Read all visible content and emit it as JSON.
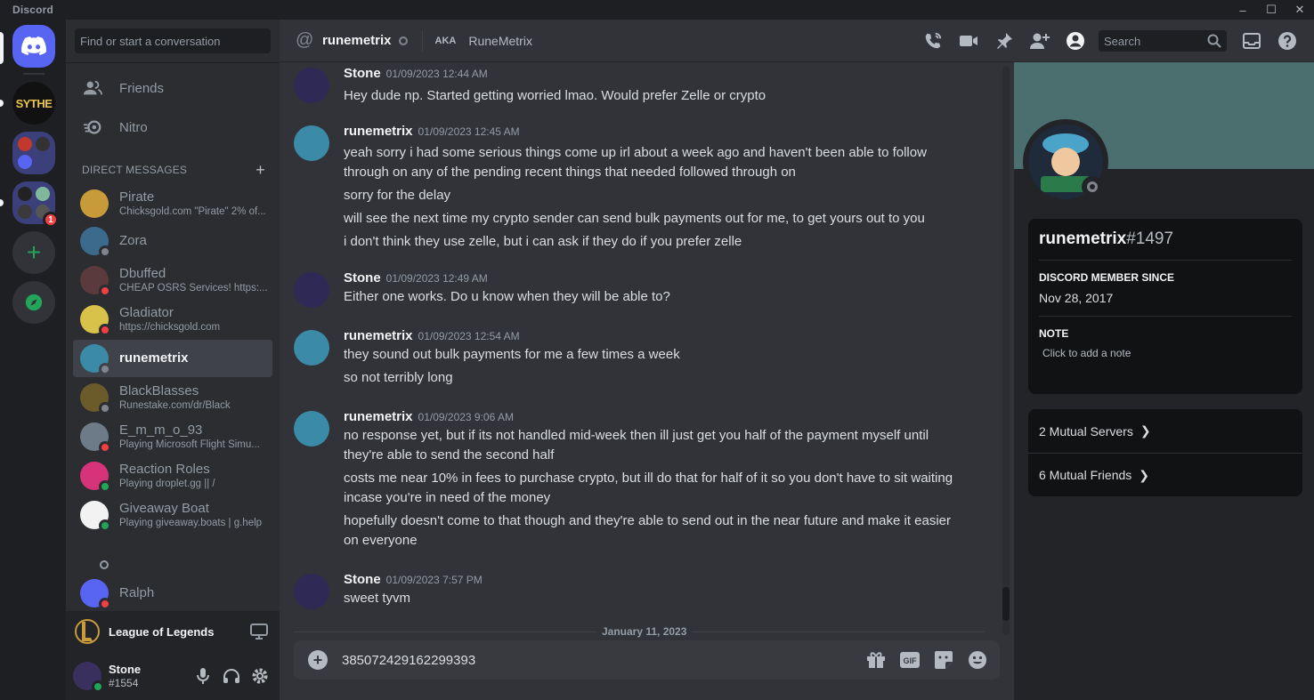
{
  "app": {
    "title": "Discord"
  },
  "window_controls": [
    "–",
    "☐",
    "✕"
  ],
  "servers": [
    {
      "name": "SYTHE",
      "label": "SYTHE"
    },
    {
      "name": "folder-1"
    },
    {
      "name": "folder-2",
      "badge": "1"
    }
  ],
  "sidebar": {
    "search_placeholder": "Find or start a conversation",
    "nav": [
      {
        "label": "Friends"
      },
      {
        "label": "Nitro"
      }
    ],
    "dm_header": "DIRECT MESSAGES",
    "dms": [
      {
        "name": "Pirate",
        "sub": "Chicksgold.com \"Pirate\" 2% of...",
        "status": "none"
      },
      {
        "name": "Zora",
        "sub": "",
        "status": "offline"
      },
      {
        "name": "Dbuffed",
        "sub": "CHEAP OSRS Services! https:...",
        "status": "dnd"
      },
      {
        "name": "Gladiator",
        "sub": "https://chicksgold.com",
        "status": "dnd"
      },
      {
        "name": "runemetrix",
        "sub": "",
        "status": "offline"
      },
      {
        "name": "BlackBlasses",
        "sub": "Runestake.com/dr/Black",
        "status": "offline"
      },
      {
        "name": "E_m_m_o_93",
        "sub": "Playing Microsoft Flight Simu...",
        "status": "dnd"
      },
      {
        "name": "Reaction Roles",
        "sub": "Playing droplet.gg || /",
        "status": "online"
      },
      {
        "name": "Giveaway Boat",
        "sub": "Playing giveaway.boats | g.help",
        "status": "online"
      },
      {
        "name": "Ralph",
        "sub": "",
        "status": "dnd"
      }
    ],
    "activity": {
      "game": "League of Legends"
    },
    "user": {
      "name": "Stone",
      "tag": "#1554"
    }
  },
  "header": {
    "channel": "runemetrix",
    "aka_label": "AKA",
    "aka_name": "RuneMetrix",
    "search_placeholder": "Search"
  },
  "messages": [
    {
      "author": "Stone",
      "time": "01/09/2023 12:44 AM",
      "lines": [
        "Hey dude np. Started getting worried lmao. Would prefer Zelle or crypto"
      ]
    },
    {
      "author": "runemetrix",
      "time": "01/09/2023 12:45 AM",
      "lines": [
        "yeah sorry i had some serious things come up irl about a week ago and haven't been able to follow through on any of the pending recent things that needed followed through on",
        "sorry for the delay",
        "will see the next time my crypto sender can send bulk payments out for me, to get yours out to you",
        "i don't think they use zelle, but i can ask if they do if you prefer zelle"
      ]
    },
    {
      "author": "Stone",
      "time": "01/09/2023 12:49 AM",
      "lines": [
        "Either one works. Do u know when they will be able to?"
      ]
    },
    {
      "author": "runemetrix",
      "time": "01/09/2023 12:54 AM",
      "lines": [
        "they sound out bulk payments for me a few times a week",
        "so not terribly long"
      ]
    },
    {
      "author": "runemetrix",
      "time": "01/09/2023 9:06 AM",
      "lines": [
        "no response yet, but if its not handled mid-week then ill just get you half of the payment myself until they're able to send the second half",
        "costs me near 10% in fees to purchase crypto, but ill do that for half of it so you don't have to sit waiting incase you're in need of the money",
        "hopefully doesn't come to that though and they're able to send out in the near future and make it easier on everyone"
      ]
    },
    {
      "author": "Stone",
      "time": "01/09/2023 7:57 PM",
      "lines": [
        "sweet tyvm"
      ]
    }
  ],
  "date_divider": "January 11, 2023",
  "composer": {
    "value": "385072429162299393"
  },
  "profile": {
    "name": "runemetrix",
    "discriminator": "#1497",
    "since_label": "DISCORD MEMBER SINCE",
    "since": "Nov 28, 2017",
    "note_label": "NOTE",
    "note_placeholder": "Click to add a note",
    "mutual_servers": "2 Mutual Servers",
    "mutual_friends": "6 Mutual Friends"
  },
  "colors": {
    "brand": "#5865f2",
    "online": "#23a559",
    "dnd": "#f23f43",
    "offline": "#80848e",
    "banner": "#4b6e6e"
  }
}
